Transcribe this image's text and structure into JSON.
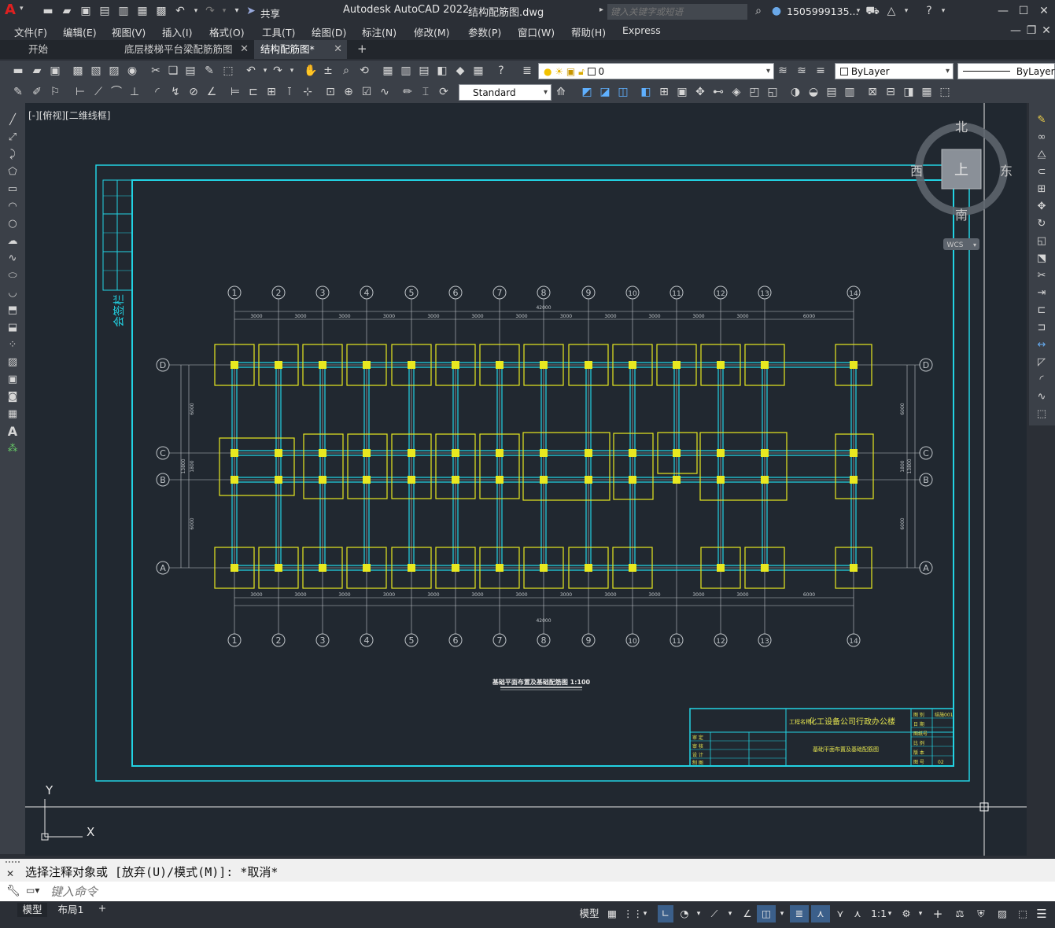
{
  "app": {
    "title": "Autodesk AutoCAD 2022",
    "filename": "结构配筋图.dwg",
    "search_placeholder": "键入关键字或短语",
    "user": "1505999135...",
    "share_label": "共享"
  },
  "menu": [
    "文件(F)",
    "编辑(E)",
    "视图(V)",
    "插入(I)",
    "格式(O)",
    "工具(T)",
    "绘图(D)",
    "标注(N)",
    "修改(M)",
    "参数(P)",
    "窗口(W)",
    "帮助(H)",
    "Express"
  ],
  "tabs": [
    {
      "label": "开始"
    },
    {
      "label": "底层楼梯平台梁配筋筋图"
    },
    {
      "label": "结构配筋图*"
    }
  ],
  "toolbar": {
    "layer_value": "0",
    "color_value": "ByLayer",
    "linetype_value": "ByLayer",
    "textstyle_value": "Standard"
  },
  "viewport_label": "[-][俯视][二维线框]",
  "viewcube": {
    "north": "北",
    "south": "南",
    "east": "东",
    "west": "西",
    "top": "上",
    "wcs": "WCS"
  },
  "ucs": {
    "x": "X",
    "y": "Y"
  },
  "drawing": {
    "grid_numbers": [
      "1",
      "2",
      "3",
      "4",
      "5",
      "6",
      "7",
      "8",
      "9",
      "10",
      "11",
      "12",
      "13",
      "14"
    ],
    "grid_letters": [
      "D",
      "C",
      "B",
      "A"
    ],
    "sign_bar_label": "会签栏",
    "top_dims": [
      "3000",
      "3000",
      "3000",
      "3000",
      "3000",
      "3000",
      "3000",
      "3000",
      "3000",
      "3000",
      "3000",
      "3000",
      "6000"
    ],
    "total_dim": "42000",
    "side_dims": [
      "6000",
      "1800",
      "6000"
    ],
    "side_total": "13800",
    "title": "基础平面布置及基础配筋图 1:100",
    "titleblock": {
      "project_label": "工程名称:",
      "project_name": "化工设备公司行政办公楼",
      "drawing_name": "基础平面布置及基础配筋图",
      "rows_left": [
        "审 定",
        "审 核",
        "设 计",
        "制 图"
      ],
      "rows_right": [
        "图 别",
        "日 期",
        "图纸号",
        "比 例",
        "版 本",
        "图 号"
      ],
      "drawing_no": "结施001",
      "page_no": "02"
    }
  },
  "command": {
    "history": "选择注释对象或 [放弃(U)/模式(M)]: *取消*",
    "placeholder": "键入命令"
  },
  "layout_tabs": [
    "模型",
    "布局1"
  ],
  "status": {
    "model": "模型",
    "scale": "1:1"
  }
}
